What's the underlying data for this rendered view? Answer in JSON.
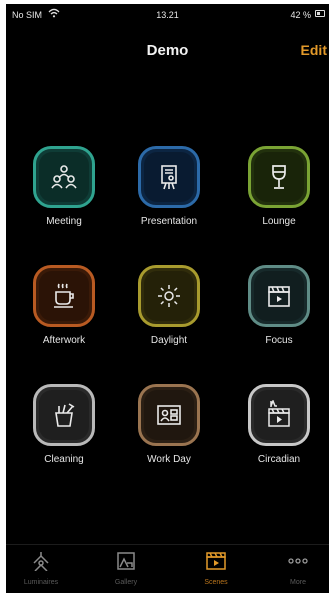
{
  "status": {
    "carrier": "No SIM",
    "time": "13.21",
    "battery": "42 %"
  },
  "nav": {
    "title": "Demo",
    "edit": "Edit"
  },
  "scenes": [
    {
      "label": "Meeting",
      "icon": "people-group-icon",
      "color": "#2fa38f"
    },
    {
      "label": "Presentation",
      "icon": "presentation-board-icon",
      "color": "#2c6aa8"
    },
    {
      "label": "Lounge",
      "icon": "wine-glass-icon",
      "color": "#7aa334"
    },
    {
      "label": "Afterwork",
      "icon": "coffee-cup-icon",
      "color": "#b85a22"
    },
    {
      "label": "Daylight",
      "icon": "sun-icon",
      "color": "#a89b2e"
    },
    {
      "label": "Focus",
      "icon": "clapperboard-icon",
      "color": "#5f8c86"
    },
    {
      "label": "Cleaning",
      "icon": "cleaning-bucket-icon",
      "color": "#b9b9b9"
    },
    {
      "label": "Work Day",
      "icon": "id-card-icon",
      "color": "#9a7450"
    },
    {
      "label": "Circadian",
      "icon": "circadian-clapperboard-icon",
      "color": "#c8c8c8"
    }
  ],
  "tabs": [
    {
      "label": "Luminaires",
      "icon": "luminaire-icon",
      "active": false
    },
    {
      "label": "Gallery",
      "icon": "gallery-icon",
      "active": false
    },
    {
      "label": "Scenes",
      "icon": "scenes-icon",
      "active": true
    },
    {
      "label": "More",
      "icon": "more-dots-icon",
      "active": false
    }
  ],
  "colors": {
    "accent": "#e39a2a",
    "background": "#000000"
  }
}
